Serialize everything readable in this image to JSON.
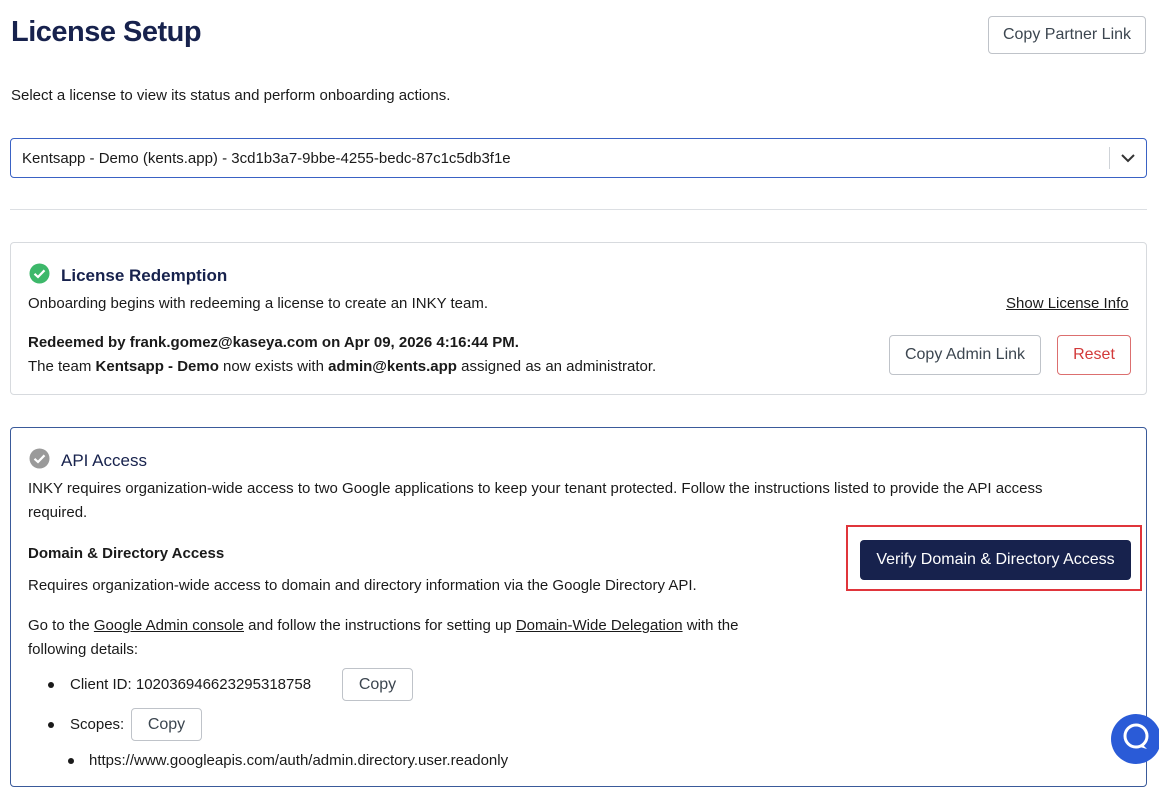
{
  "page": {
    "title": "License Setup",
    "copy_partner_link": "Copy Partner Link",
    "subtitle": "Select a license to view its status and perform onboarding actions."
  },
  "license_select": {
    "value": "Kentsapp - Demo (kents.app) - 3cd1b3a7-9bbe-4255-bedc-87c1c5db3f1e",
    "icon": "chevron-down-icon"
  },
  "redemption": {
    "title": "License Redemption",
    "status_icon": "check-circle-icon",
    "status_color": "#3db86a",
    "description": "Onboarding begins with redeeming a license to create an INKY team.",
    "show_info_link": "Show License Info",
    "redeemed_line": "Redeemed by frank.gomez@kaseya.com on Apr 09, 2026 4:16:44 PM.",
    "team_prefix": "The team ",
    "team_name": "Kentsapp - Demo",
    "team_mid": " now exists with ",
    "team_admin": "admin@kents.app",
    "team_suffix": " assigned as an administrator.",
    "copy_admin_link": "Copy Admin Link",
    "reset": "Reset"
  },
  "api_access": {
    "title": "API Access",
    "status_icon": "pending-check-circle-icon",
    "status_color": "#9a9a9a",
    "description_line1": "INKY requires organization-wide access to two Google applications to keep your tenant protected. Follow the instructions listed to provide the API access",
    "description_line2": "required.",
    "section_title": "Domain & Directory Access",
    "verify_button": "Verify Domain & Directory Access",
    "section_desc": "Requires organization-wide access to domain and directory information via the Google Directory API.",
    "goto_prefix": "Go to the ",
    "admin_console_link": "Google Admin console",
    "goto_mid": " and follow the instructions for setting up ",
    "delegation_link": "Domain-Wide Delegation",
    "goto_suffix": " with the",
    "goto_line2": "following details:",
    "client_id_label": "Client ID: 102036946623295318758",
    "copy_label": "Copy",
    "scopes_label": "Scopes:",
    "scope_item": "https://www.googleapis.com/auth/admin.directory.user.readonly"
  },
  "chat": {
    "icon": "chat-bubble-icon",
    "color": "#2a5bd7"
  }
}
